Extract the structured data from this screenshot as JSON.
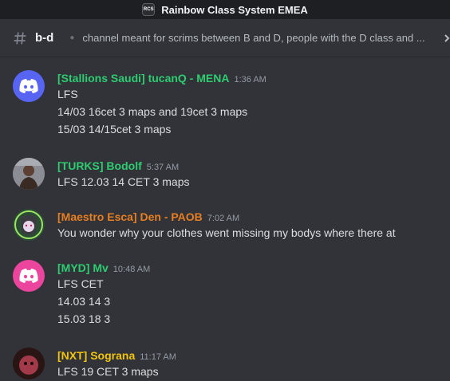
{
  "window": {
    "title": "Rainbow Class System EMEA",
    "server_icon_text": "RCS"
  },
  "channel": {
    "name": "b-d",
    "topic": "channel meant for scrims between B and D, people with the D class and ..."
  },
  "messages": [
    {
      "author": "[Stallions Saudi] tucanQ - MENA",
      "color": "#2ecc71",
      "time": "1:36 AM",
      "lines": [
        "LFS",
        "14/03 16cet 3 maps and 19cet 3 maps",
        "15/03 14/15cet 3 maps"
      ]
    },
    {
      "author": "[TURKS] Bodolf",
      "color": "#2ecc71",
      "time": "5:37 AM",
      "lines": [
        "LFS 12.03 14 CET 3 maps"
      ]
    },
    {
      "author": "[Maestro Esca] Den - PAOB",
      "color": "#e67e22",
      "time": "7:02 AM",
      "lines": [
        "You wonder why your clothes went missing my bodys where there at"
      ]
    },
    {
      "author": "[MYD] Mv",
      "color": "#2ecc71",
      "time": "10:48 AM",
      "lines": [
        "LFS CET",
        "14.03 14 3",
        "15.03 18 3"
      ]
    },
    {
      "author": "[NXT] Sograna",
      "color": "#f1c40f",
      "time": "11:17 AM",
      "lines": [
        "LFS 19 CET 3 maps"
      ]
    }
  ]
}
